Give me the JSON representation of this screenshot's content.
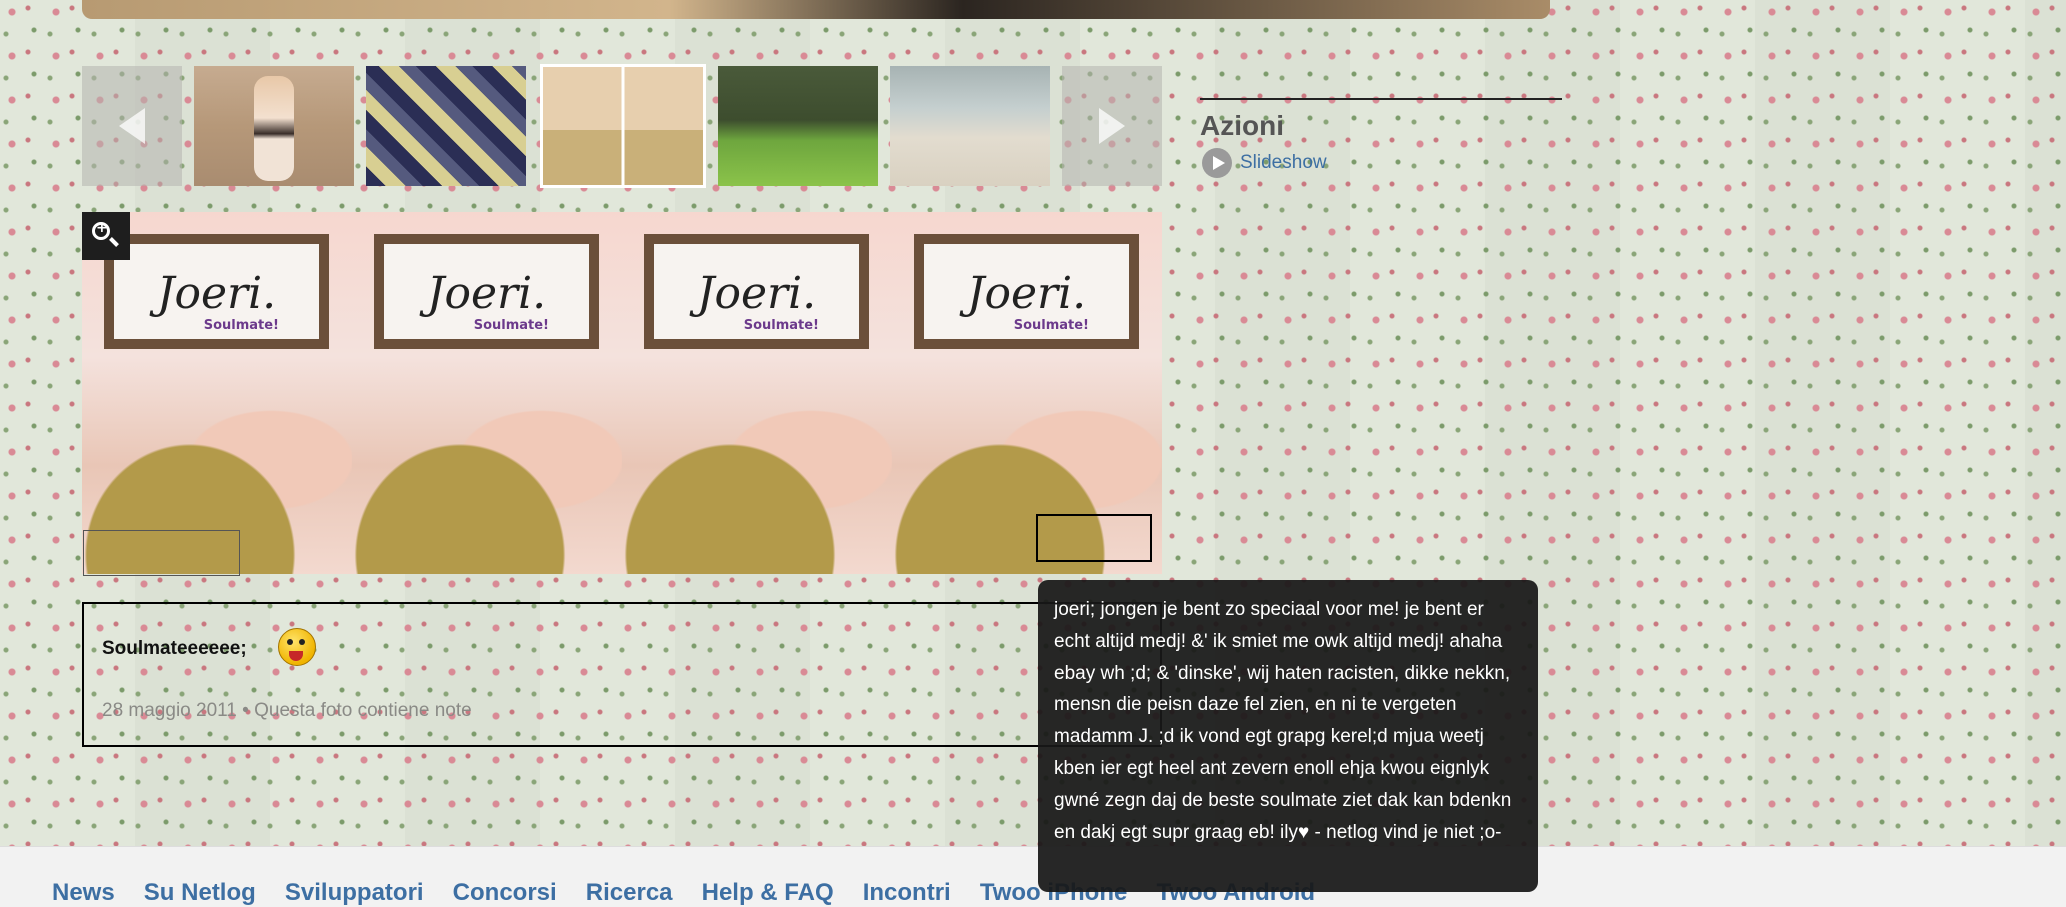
{
  "gallery": {
    "thumbnails": [
      {
        "name": "thumb-1"
      },
      {
        "name": "thumb-2"
      },
      {
        "name": "thumb-3"
      },
      {
        "name": "thumb-4"
      },
      {
        "name": "thumb-5"
      }
    ],
    "selected_index": 2
  },
  "photo": {
    "sign_text": "Joeri.",
    "sign_sub": "Soulmate!",
    "panels": 4
  },
  "caption": {
    "title": "Soulmateeeeee;",
    "date": "28 maggio 2011",
    "separator": "•",
    "notes": "Questa foto contiene note"
  },
  "actions": {
    "title": "Azioni",
    "slideshow_label": "Slideshow"
  },
  "tooltip": {
    "text": "joeri; jongen je bent zo speciaal voor me! je bent er echt altijd medj! &' ik smiet me owk altijd medj! ahaha ebay wh ;d; & 'dinske', wij haten racisten, dikke nekkn, mensn die peisn daze fel zien, en ni te vergeten madamm J. ;d ik vond egt grapg kerel;d mjua weetj kben ier egt heel ant zevern enoll ehja kwou eignlyk gwné zegn daj de beste soulmate ziet dak kan bdenkn en dakj egt supr graag eb! ily♥ - netlog vind je niet ;o-"
  },
  "footer": {
    "links": [
      "News",
      "Su Netlog",
      "Sviluppatori",
      "Concorsi",
      "Ricerca",
      "Help & FAQ",
      "Incontri",
      "Twoo iPhone",
      "Twoo Android"
    ]
  },
  "colors": {
    "link": "#3d6fa3",
    "tooltip_bg": "#181818"
  }
}
